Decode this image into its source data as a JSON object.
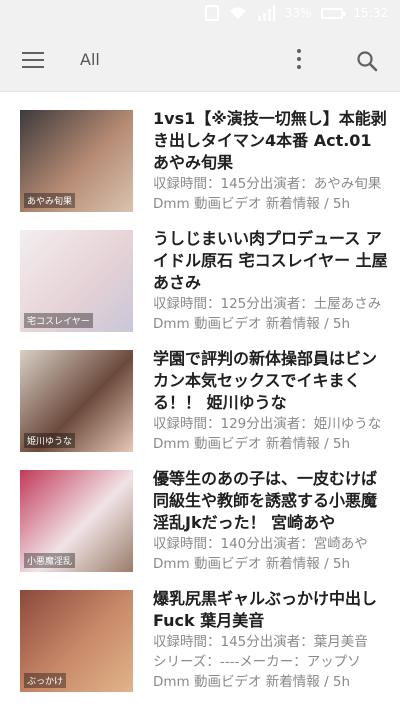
{
  "status_bar": {
    "battery": "33%",
    "time": "15:32"
  },
  "toolbar": {
    "title": "All"
  },
  "items": [
    {
      "title": "1vs1【※演技一切無し】本能剥き出しタイマン4本番 Act.01 あやみ旬果",
      "meta_lines": [
        "収録時間：145分出演者：あやみ旬果",
        "Dmm 動画ビデオ 新着情報 / 5h"
      ],
      "thumb_text": "あやみ旬果",
      "thumb_colors": [
        "#3d3a3c",
        "#b58a73",
        "#d9c4b0"
      ]
    },
    {
      "title": "うしじまいい肉プロデュース アイドル原石 宅コスレイヤー 土屋あさみ",
      "meta_lines": [
        "収録時間：125分出演者：土屋あさみ",
        "Dmm 動画ビデオ 新着情報 / 5h"
      ],
      "thumb_text": "宅コスレイヤー",
      "thumb_colors": [
        "#f3eef0",
        "#e6d3d6",
        "#c9c6d8"
      ]
    },
    {
      "title": "学園で評判の新体操部員はビンカン本気セックスでイキまくる！！ 姫川ゆうな",
      "meta_lines": [
        "収録時間：129分出演者：姫川ゆうな",
        "Dmm 動画ビデオ 新着情報 / 5h"
      ],
      "thumb_text": "姫川ゆうな",
      "thumb_colors": [
        "#d8d0c6",
        "#6b4a3c",
        "#e8c9b8"
      ]
    },
    {
      "title": "優等生のあの子は、一皮むけば同級生や教師を誘惑する小悪魔淫乱Jkだった！ 宮崎あや",
      "meta_lines": [
        "収録時間：140分出演者：宮崎あや",
        "Dmm 動画ビデオ 新着情報 / 5h"
      ],
      "thumb_text": "小悪魔淫乱",
      "thumb_colors": [
        "#c23a5a",
        "#f1e3e6",
        "#9a7c6a"
      ]
    },
    {
      "title": "爆乳尻黒ギャルぶっかけ中出しFuck 葉月美音",
      "meta_lines": [
        "収録時間：145分出演者：葉月美音",
        "シリーズ：----メーカー：アップソ",
        "Dmm 動画ビデオ 新着情報 / 5h"
      ],
      "thumb_text": "ぶっかけ",
      "thumb_colors": [
        "#8a4a3a",
        "#c98a6a",
        "#e0b48a"
      ]
    }
  ]
}
